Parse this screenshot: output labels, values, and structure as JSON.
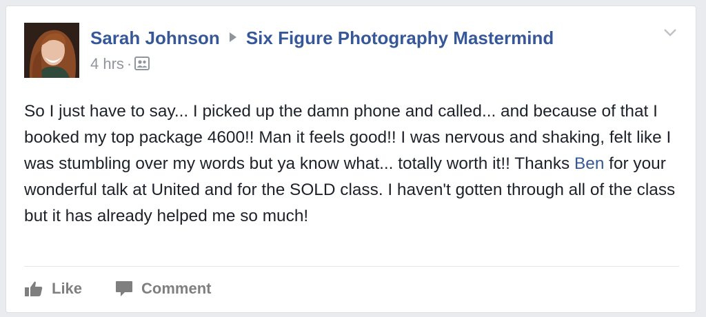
{
  "post": {
    "author": "Sarah Johnson",
    "group": "Six Figure Photography Mastermind",
    "time": "4 hrs",
    "separator": "·",
    "body": {
      "part1": "So I just have to say... I picked up the damn phone and called... and because of that I booked my top package 4600!! Man it feels good!! I was nervous and shaking, felt like I was stumbling over my words but ya know what... totally worth it!! Thanks ",
      "mention": "Ben",
      "part2": " for your wonderful talk at United and for the SOLD class. I haven't gotten through all of the class but it has already helped me so much!"
    },
    "audience_icon": "group-audience-icon",
    "menu_icon": "chevron-down-icon"
  },
  "actions": {
    "like_label": "Like",
    "comment_label": "Comment",
    "like_icon": "thumbs-up-icon",
    "comment_icon": "speech-bubble-icon"
  },
  "colors": {
    "link": "#365899",
    "text": "#1d2129",
    "muted": "#90949c",
    "action": "#7f7f7f",
    "page_bg": "#e9ebee"
  }
}
